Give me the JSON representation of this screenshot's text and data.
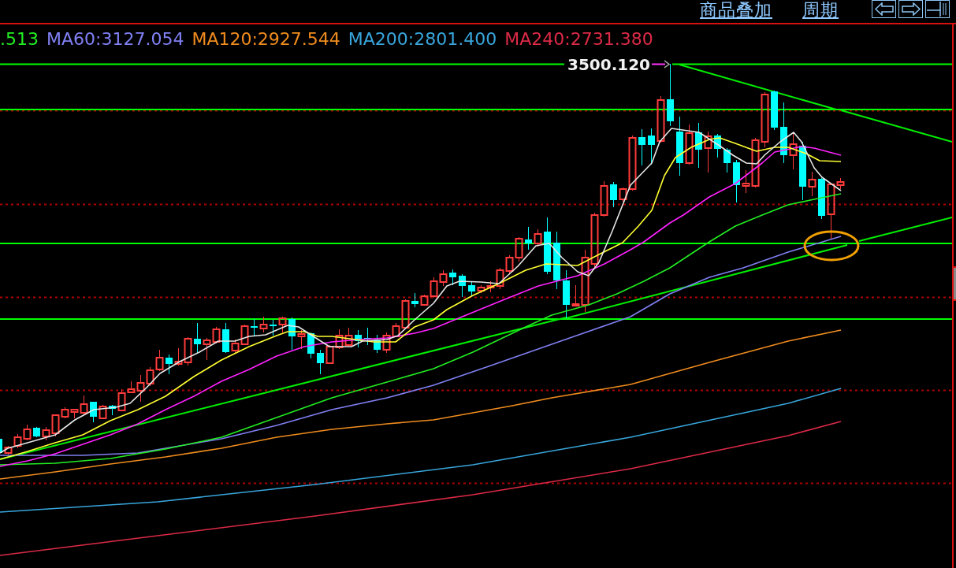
{
  "toolbar": {
    "links": [
      "商品叠加",
      "周期"
    ]
  },
  "legend": [
    {
      "label": ".513",
      "color": "#22ee22"
    },
    {
      "label": "MA60:3127.054",
      "color": "#8080f4"
    },
    {
      "label": "MA120:2927.544",
      "color": "#f08c1e"
    },
    {
      "label": "MA200:2801.400",
      "color": "#38a6dc"
    },
    {
      "label": "MA240:2731.380",
      "color": "#dc2a46"
    }
  ],
  "chart": {
    "peak_label": "3500.120"
  }
}
